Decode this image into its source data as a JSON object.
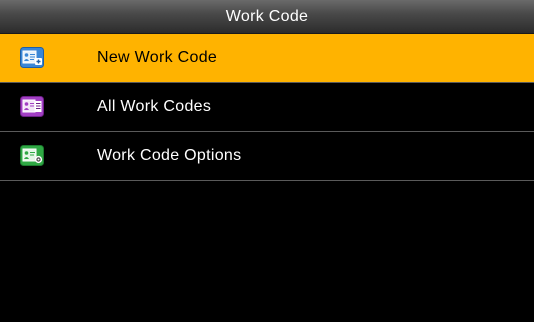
{
  "window": {
    "title": "Work Code"
  },
  "menu": {
    "items": [
      {
        "label": "New Work Code",
        "icon": "new-work-code-icon",
        "icon_color": "#3a86d6",
        "selected": true
      },
      {
        "label": "All Work Codes",
        "icon": "all-work-codes-icon",
        "icon_color": "#a23fc4",
        "selected": false
      },
      {
        "label": "Work Code Options",
        "icon": "work-code-options-icon",
        "icon_color": "#2fa844",
        "selected": false
      }
    ]
  },
  "colors": {
    "selected_background": "#ffb300",
    "screen_background": "#000000",
    "divider": "#5a5a5a"
  }
}
